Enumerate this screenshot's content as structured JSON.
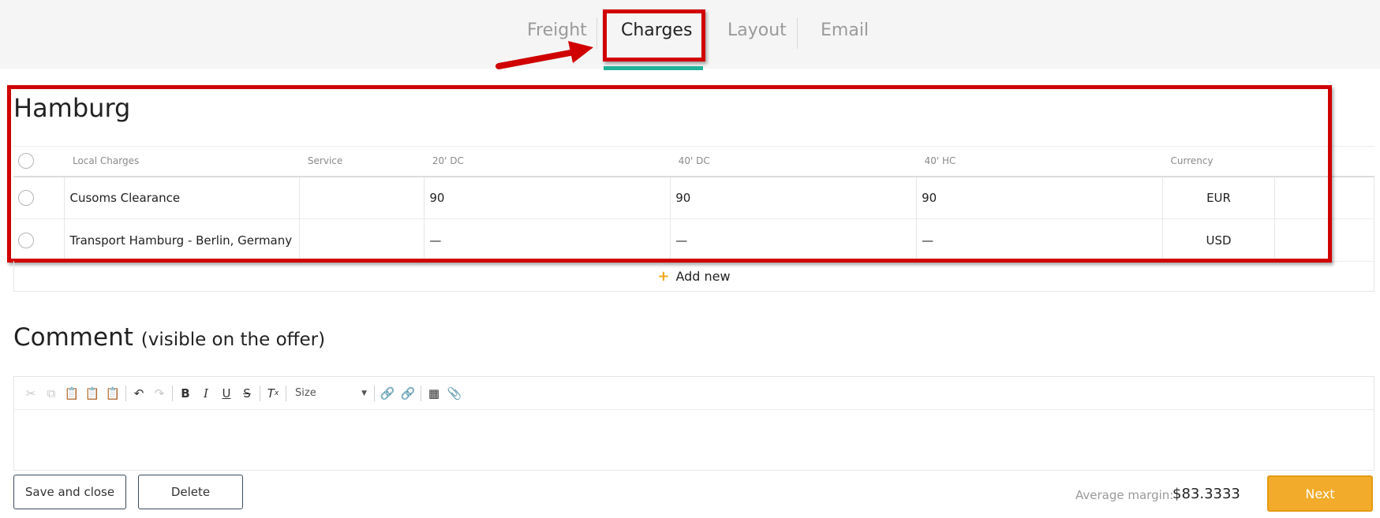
{
  "tabs": [
    {
      "label": "Freight"
    },
    {
      "label": "Charges",
      "active": true
    },
    {
      "label": "Layout"
    },
    {
      "label": "Email"
    }
  ],
  "section": {
    "title": "Hamburg",
    "columns": [
      "Local Charges",
      "Service",
      "20' DC",
      "40' DC",
      "40' HC",
      "Currency"
    ],
    "rows": [
      {
        "name": "Cusoms Clearance",
        "service": "",
        "dc20": "90",
        "dc40": "90",
        "hc40": "90",
        "currency": "EUR"
      },
      {
        "name": "Transport Hamburg - Berlin, Germany",
        "service": "",
        "dc20": "—",
        "dc40": "—",
        "hc40": "—",
        "currency": "USD"
      }
    ],
    "add_new_label": "Add new"
  },
  "comment": {
    "title": "Comment",
    "subtitle": "(visible on the offer)",
    "size_label": "Size"
  },
  "footer": {
    "save_label": "Save and close",
    "delete_label": "Delete",
    "margin_label": "Average margin:",
    "margin_value": "$83.3333",
    "next_label": "Next"
  },
  "colors": {
    "accent_tab": "#21b39a",
    "next_button": "#f2ab2a",
    "annotation": "#d00000"
  },
  "icons": [
    "cut-icon",
    "copy-icon",
    "paste-icon",
    "paste-text-icon",
    "paste-word-icon",
    "undo-icon",
    "redo-icon",
    "bold-icon",
    "italic-icon",
    "underline-icon",
    "strike-icon",
    "clear-format-icon",
    "link-icon",
    "unlink-icon",
    "table-icon",
    "attach-icon",
    "plus-icon",
    "arrow-annotation-icon"
  ]
}
